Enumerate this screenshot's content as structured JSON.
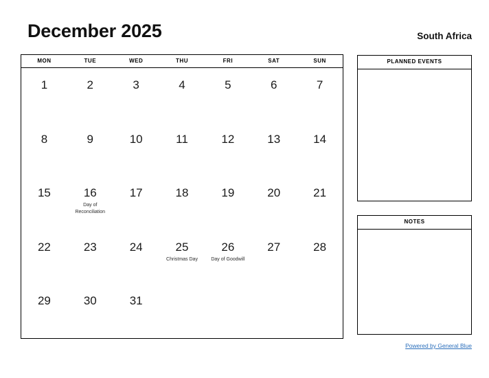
{
  "header": {
    "title": "December 2025",
    "country": "South Africa"
  },
  "calendar": {
    "weekdays": [
      "MON",
      "TUE",
      "WED",
      "THU",
      "FRI",
      "SAT",
      "SUN"
    ],
    "weeks": [
      [
        {
          "day": "1",
          "event": ""
        },
        {
          "day": "2",
          "event": ""
        },
        {
          "day": "3",
          "event": ""
        },
        {
          "day": "4",
          "event": ""
        },
        {
          "day": "5",
          "event": ""
        },
        {
          "day": "6",
          "event": ""
        },
        {
          "day": "7",
          "event": ""
        }
      ],
      [
        {
          "day": "8",
          "event": ""
        },
        {
          "day": "9",
          "event": ""
        },
        {
          "day": "10",
          "event": ""
        },
        {
          "day": "11",
          "event": ""
        },
        {
          "day": "12",
          "event": ""
        },
        {
          "day": "13",
          "event": ""
        },
        {
          "day": "14",
          "event": ""
        }
      ],
      [
        {
          "day": "15",
          "event": ""
        },
        {
          "day": "16",
          "event": "Day of Reconciliation"
        },
        {
          "day": "17",
          "event": ""
        },
        {
          "day": "18",
          "event": ""
        },
        {
          "day": "19",
          "event": ""
        },
        {
          "day": "20",
          "event": ""
        },
        {
          "day": "21",
          "event": ""
        }
      ],
      [
        {
          "day": "22",
          "event": ""
        },
        {
          "day": "23",
          "event": ""
        },
        {
          "day": "24",
          "event": ""
        },
        {
          "day": "25",
          "event": "Christmas Day"
        },
        {
          "day": "26",
          "event": "Day of Goodwill"
        },
        {
          "day": "27",
          "event": ""
        },
        {
          "day": "28",
          "event": ""
        }
      ],
      [
        {
          "day": "29",
          "event": ""
        },
        {
          "day": "30",
          "event": ""
        },
        {
          "day": "31",
          "event": ""
        },
        {
          "day": "",
          "event": ""
        },
        {
          "day": "",
          "event": ""
        },
        {
          "day": "",
          "event": ""
        },
        {
          "day": "",
          "event": ""
        }
      ]
    ]
  },
  "panels": [
    {
      "title": "PLANNED EVENTS",
      "content": ""
    },
    {
      "title": "NOTES",
      "content": ""
    }
  ],
  "footer": {
    "link_text": "Powered by General Blue",
    "link_color": "#2a6ebb"
  }
}
